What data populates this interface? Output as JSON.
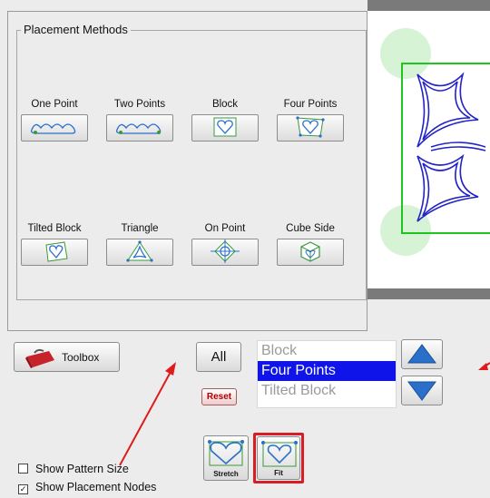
{
  "panel": {
    "title": "Placement Methods",
    "methods": [
      {
        "label": "One Point",
        "icon": "one-point-icon"
      },
      {
        "label": "Two Points",
        "icon": "two-points-icon"
      },
      {
        "label": "Block",
        "icon": "block-icon"
      },
      {
        "label": "Four Points",
        "icon": "four-points-icon"
      },
      {
        "label": "Tilted Block",
        "icon": "tilted-block-icon"
      },
      {
        "label": "Triangle",
        "icon": "triangle-icon"
      },
      {
        "label": "On Point",
        "icon": "on-point-icon"
      },
      {
        "label": "Cube Side",
        "icon": "cube-side-icon"
      }
    ]
  },
  "controls": {
    "toolbox_label": "Toolbox",
    "all_label": "All",
    "reset_label": "Reset",
    "list_items": [
      {
        "label": "Block",
        "selected": false
      },
      {
        "label": "Four Points",
        "selected": true
      },
      {
        "label": "Tilted Block",
        "selected": false
      }
    ],
    "stretch_label": "Stretch",
    "fit_label": "Fit"
  },
  "options": {
    "show_pattern_size": {
      "label": "Show Pattern Size",
      "checked": false
    },
    "show_placement_nodes": {
      "label": "Show Placement Nodes",
      "checked": true
    }
  },
  "colors": {
    "selection": "#0f14e8",
    "arrow_blue": "#2a6fc9",
    "annotation_red": "#e01b1b",
    "fit_highlight": "#d81d25",
    "pattern_green": "#1ec51e",
    "pattern_blue": "#2323c8"
  }
}
